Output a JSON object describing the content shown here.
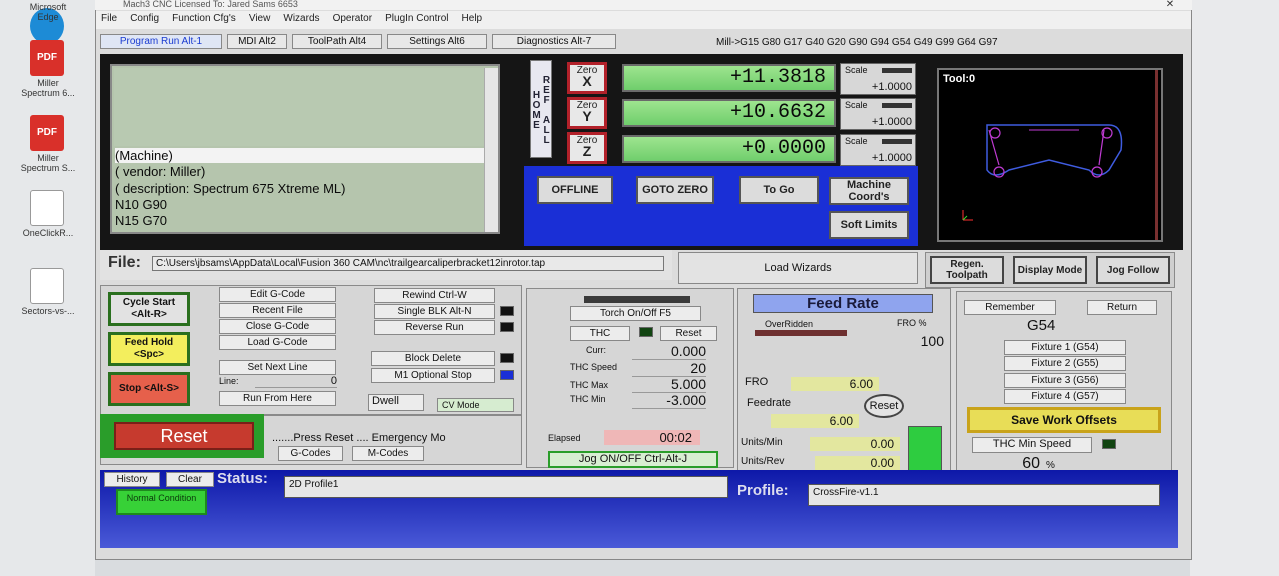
{
  "desktop": {
    "icons": [
      {
        "label": "Microsoft Edge",
        "type": "browser"
      },
      {
        "label": "Miller Spectrum 6...",
        "type": "pdf"
      },
      {
        "label": "Miller Spectrum S...",
        "type": "pdf"
      },
      {
        "label": "OneClickR...",
        "type": "doc"
      },
      {
        "label": "Sectors-vs-...",
        "type": "doc"
      }
    ],
    "pdf_text": "PDF"
  },
  "window": {
    "title": "Mach3 CNC  Licensed To: Jared Sams 6653",
    "close_glyph": "✕",
    "menu": [
      "File",
      "Config",
      "Function Cfg's",
      "View",
      "Wizards",
      "Operator",
      "PlugIn Control",
      "Help"
    ]
  },
  "tabs": [
    "Program Run Alt-1",
    "MDI Alt2",
    "ToolPath Alt4",
    "Settings Alt6",
    "Diagnostics Alt-7"
  ],
  "modal_gcodes": "Mill->G15  G80 G17 G40 G20 G90 G94 G54 G49 G99 G64 G97",
  "gcode": {
    "lines": [
      "(Machine)",
      "(  vendor: Miller)",
      "(  description: Spectrum 675 Xtreme ML)",
      "N10 G90",
      "N15 G70"
    ]
  },
  "ref_all_home": "REF ALL HOME",
  "axes": [
    {
      "zero": "Zero",
      "axis": "X",
      "value": "+11.3818",
      "scale_label": "Scale",
      "scale": "+1.0000"
    },
    {
      "zero": "Zero",
      "axis": "Y",
      "value": "+10.6632",
      "scale_label": "Scale",
      "scale": "+1.0000"
    },
    {
      "zero": "Zero",
      "axis": "Z",
      "value": "+0.0000",
      "scale_label": "Scale",
      "scale": "+1.0000"
    }
  ],
  "dro_buttons": {
    "offline": "OFFLINE",
    "goto_zero": "GOTO ZERO",
    "to_go": "To Go",
    "machine_coords": "Machine Coord's",
    "soft_limits": "Soft Limits"
  },
  "toolpath": {
    "label": "Tool:0"
  },
  "file": {
    "label": "File:",
    "path": "C:\\Users\\jbsams\\AppData\\Local\\Fusion 360 CAM\\nc\\trailgearcaliperbracket12inrotor.tap"
  },
  "wizards": "Load Wizards",
  "view_buttons": {
    "regen": "Regen. Toolpath",
    "display": "Display Mode",
    "jog_follow": "Jog Follow"
  },
  "cycle": {
    "start": "Cycle Start <Alt-R>",
    "hold": "Feed Hold <Spc>",
    "stop": "Stop <Alt-S>",
    "reset": "Reset"
  },
  "program_buttons": {
    "edit": "Edit G-Code",
    "recent": "Recent File",
    "close": "Close G-Code",
    "load": "Load G-Code",
    "set_next": "Set Next Line",
    "line_label": "Line:",
    "line_value": "0",
    "run_from_here": "Run From Here",
    "rewind": "Rewind Ctrl-W",
    "single": "Single BLK Alt-N",
    "reverse": "Reverse Run",
    "block_delete": "Block Delete",
    "m1": "M1 Optional Stop",
    "dwell": "Dwell",
    "cv_mode": "CV Mode"
  },
  "reset_hint": ".......Press Reset .... Emergency Mo",
  "gcodes_btn": "G-Codes",
  "mcodes_btn": "M-Codes",
  "thc": {
    "torch": "Torch On/Off F5",
    "thc": "THC",
    "reset": "Reset",
    "curr_label": "Curr:",
    "curr": "0.000",
    "speed_label": "THC Speed",
    "speed": "20",
    "max_label": "THC Max",
    "max": "5.000",
    "min_label": "THC Min",
    "min": "-3.000",
    "elapsed_label": "Elapsed",
    "elapsed": "00:02",
    "jog": "Jog ON/OFF Ctrl-Alt-J"
  },
  "feed": {
    "title": "Feed Rate",
    "overridden": "OverRidden",
    "fro_pct_label": "FRO %",
    "fro_pct": "100",
    "fro_label": "FRO",
    "fro": "6.00",
    "feedrate_label": "Feedrate",
    "feedrate": "6.00",
    "reset": "Reset",
    "units_min_label": "Units/Min",
    "units_min": "0.00",
    "units_rev_label": "Units/Rev",
    "units_rev": "0.00"
  },
  "offsets": {
    "remember": "Remember",
    "return": "Return",
    "current": "G54",
    "fixtures": [
      "Fixture 1 (G54)",
      "Fixture 2 (G55)",
      "Fixture 3 (G56)",
      "Fixture 4 (G57)"
    ],
    "save": "Save Work Offsets",
    "thc_min": "THC Min Speed",
    "thc_min_val": "60",
    "pct": "%"
  },
  "status": {
    "history": "History",
    "clear": "Clear",
    "label": "Status:",
    "text": "2D Profile1",
    "profile_label": "Profile:",
    "profile": "CrossFire-v1.1",
    "normal": "Normal Condition"
  },
  "colors": {
    "accent_blue": "#1a2fd6",
    "dro_green": "#7fd97a",
    "reset_red": "#c0392b",
    "led_green": "#2ecc40"
  }
}
